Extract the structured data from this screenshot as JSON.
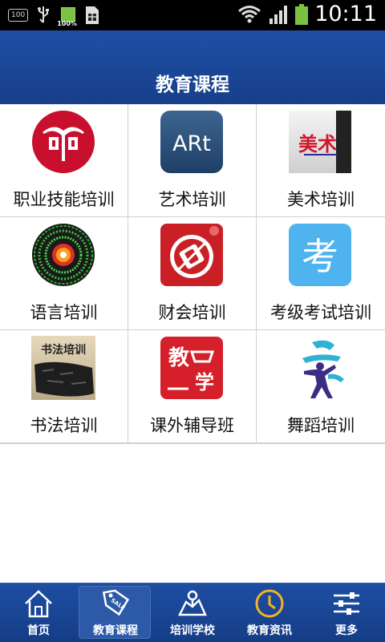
{
  "status_bar": {
    "notification_badge": "100",
    "battery_percent": "100%",
    "clock": "10:11",
    "icons": [
      "usb-icon",
      "battery-small-icon",
      "sim-icon",
      "wifi-icon",
      "signal-icon",
      "battery-icon"
    ]
  },
  "header": {
    "title": "教育课程"
  },
  "courses": [
    {
      "label": "职业技能培训",
      "icon": "vocational-logo-icon"
    },
    {
      "label": "艺术培训",
      "icon": "art-icon"
    },
    {
      "label": "美术培训",
      "icon": "fine-art-icon"
    },
    {
      "label": "语言培训",
      "icon": "language-icon"
    },
    {
      "label": "财会培训",
      "icon": "accounting-icon"
    },
    {
      "label": "考级考试培训",
      "icon": "exam-icon"
    },
    {
      "label": "书法培训",
      "icon": "calligraphy-icon"
    },
    {
      "label": "课外辅导班",
      "icon": "tutoring-icon"
    },
    {
      "label": "舞蹈培训",
      "icon": "dance-icon"
    }
  ],
  "icon_texts": {
    "art": "ARt",
    "fine_art": "美术",
    "exam": "考",
    "calligraphy": "书法培训",
    "tutoring_a": "教",
    "tutoring_b": "学"
  },
  "tabs": [
    {
      "label": "首页",
      "icon": "home-icon",
      "active": false
    },
    {
      "label": "教育课程",
      "icon": "tag-icon",
      "active": true
    },
    {
      "label": "培训学校",
      "icon": "map-icon",
      "active": false
    },
    {
      "label": "教育资讯",
      "icon": "clock-icon",
      "active": false
    },
    {
      "label": "更多",
      "icon": "settings-sliders-icon",
      "active": false
    }
  ],
  "colors": {
    "header_bg": "#1f4fa5",
    "tab_bg": "#1d4ea3",
    "accent_red": "#c8102e"
  }
}
